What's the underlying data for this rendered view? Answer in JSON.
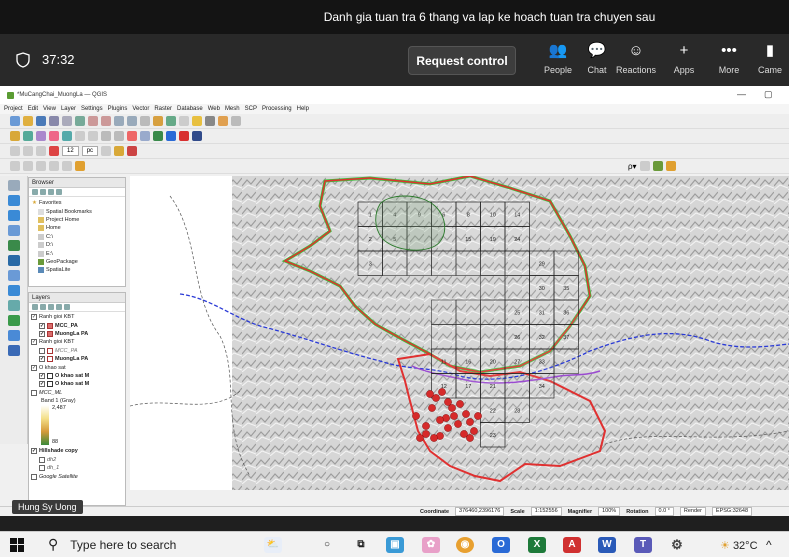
{
  "teams": {
    "meeting_title": "Danh gia tuan tra 6 thang va lap ke hoach tuan tra chuyen sau",
    "timer": "37:32",
    "request_control": "Request control",
    "actions": [
      "People",
      "Chat",
      "Reactions",
      "Apps",
      "More",
      "Came"
    ],
    "participant_name": "Hung Sy Uong"
  },
  "qgis": {
    "window_title": "*MuCangChai_MuongLa — QGIS",
    "menu": [
      "Project",
      "Edit",
      "View",
      "Layer",
      "Settings",
      "Plugins",
      "Vector",
      "Raster",
      "Database",
      "Web",
      "Mesh",
      "SCP",
      "Processing",
      "Help"
    ],
    "toolbar": {
      "font_size": "12",
      "unit": "pc"
    },
    "browser": {
      "title": "Browser",
      "items": [
        "Favorites",
        "Spatial Bookmarks",
        "Project Home",
        "Home",
        "C:\\",
        "D:\\",
        "E:\\",
        "GeoPackage",
        "SpatiaLite"
      ]
    },
    "layers": {
      "title": "Layers",
      "items": [
        {
          "label": "Ranh gioi KBT",
          "checked": true,
          "style": "group"
        },
        {
          "label": "MCC_PA",
          "checked": true,
          "style": "bold",
          "color": "#d86c6c"
        },
        {
          "label": "MuongLa PA",
          "checked": true,
          "style": "bold",
          "color": "#d86c6c"
        },
        {
          "label": "Ranh gioi KBT",
          "checked": true,
          "style": "group"
        },
        {
          "label": "MCC_PA",
          "checked": false,
          "style": "italic",
          "color": "#ffffff"
        },
        {
          "label": "MuongLa PA",
          "checked": true,
          "style": "bold",
          "color": "#ffffff"
        },
        {
          "label": "O khao sat",
          "checked": true,
          "style": "group"
        },
        {
          "label": "O khao sat M",
          "checked": true,
          "style": "bold",
          "color": "#ffffff"
        },
        {
          "label": "O khao sat M",
          "checked": true,
          "style": "bold",
          "color": "#ffffff"
        },
        {
          "label": "MCC_ML",
          "checked": false,
          "style": "italic"
        },
        {
          "label": "Band 1 (Gray)",
          "checked": false,
          "style": "plain"
        },
        {
          "label": "2,487",
          "checked": false,
          "style": "plain"
        },
        {
          "label": "88",
          "checked": false,
          "style": "plain"
        },
        {
          "label": "Hillshade copy",
          "checked": true,
          "style": "bold"
        },
        {
          "label": "dh2",
          "checked": false,
          "style": "italic"
        },
        {
          "label": "dh_1",
          "checked": false,
          "style": "italic"
        },
        {
          "label": "Google Satellite",
          "checked": false,
          "style": "italic"
        }
      ]
    },
    "grid_cells": [
      "1",
      "4",
      "9",
      "6",
      "8",
      "10",
      "14",
      "2",
      "5",
      "15",
      "19",
      "24",
      "3",
      "29",
      "30",
      "35",
      "25",
      "31",
      "36",
      "26",
      "32",
      "37",
      "11",
      "16",
      "20",
      "27",
      "33",
      "12",
      "17",
      "21",
      "34",
      "28",
      "22",
      "23"
    ],
    "status": {
      "coordinate_label": "Coordinate",
      "coordinate": "376460,2396176",
      "scale_label": "Scale",
      "scale": "1:152556",
      "magnifier_label": "Magnifier",
      "magnifier": "100%",
      "rotation_label": "Rotation",
      "rotation": "0.0 °",
      "render": "Render",
      "crs": "EPSG:32648"
    }
  },
  "taskbar": {
    "search_placeholder": "Type here to search",
    "temperature": "32°C"
  }
}
